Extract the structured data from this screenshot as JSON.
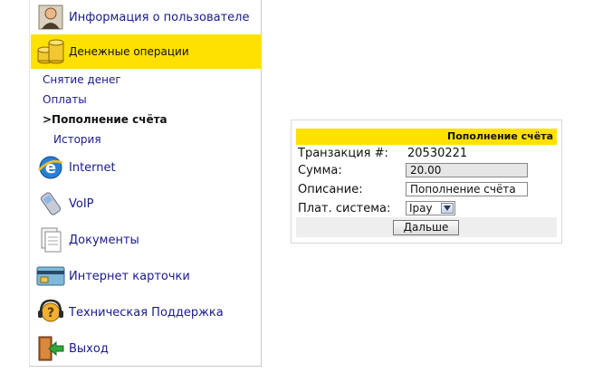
{
  "sidebar": {
    "items": [
      {
        "label": "Информация о пользователе",
        "icon": "user-icon"
      },
      {
        "label": "Денежные операции",
        "icon": "coins-icon"
      },
      {
        "label": "Internet",
        "icon": "internet-explorer-icon"
      },
      {
        "label": "VoIP",
        "icon": "phone-icon"
      },
      {
        "label": "Документы",
        "icon": "documents-icon"
      },
      {
        "label": "Интернет карточки",
        "icon": "card-icon"
      },
      {
        "label": "Техническая Поддержка",
        "icon": "headset-icon"
      },
      {
        "label": "Выход",
        "icon": "exit-icon"
      }
    ],
    "submenu": [
      {
        "label": "Снятие денег"
      },
      {
        "label": "Оплаты"
      },
      {
        "label": ">Пополнение счёта"
      },
      {
        "label": "История"
      }
    ]
  },
  "panel": {
    "title": "Пополнение счёта",
    "transaction_label": "Транзакция #:",
    "transaction_value": "20530221",
    "amount_label": "Сумма:",
    "amount_value": "20.00",
    "description_label": "Описание:",
    "description_value": "Пополнение счёта",
    "system_label": "Плат. система:",
    "system_value": "Ipay",
    "next_button": "Дальше"
  },
  "colors": {
    "accent": "#ffe100",
    "link": "#1a1a8c"
  }
}
